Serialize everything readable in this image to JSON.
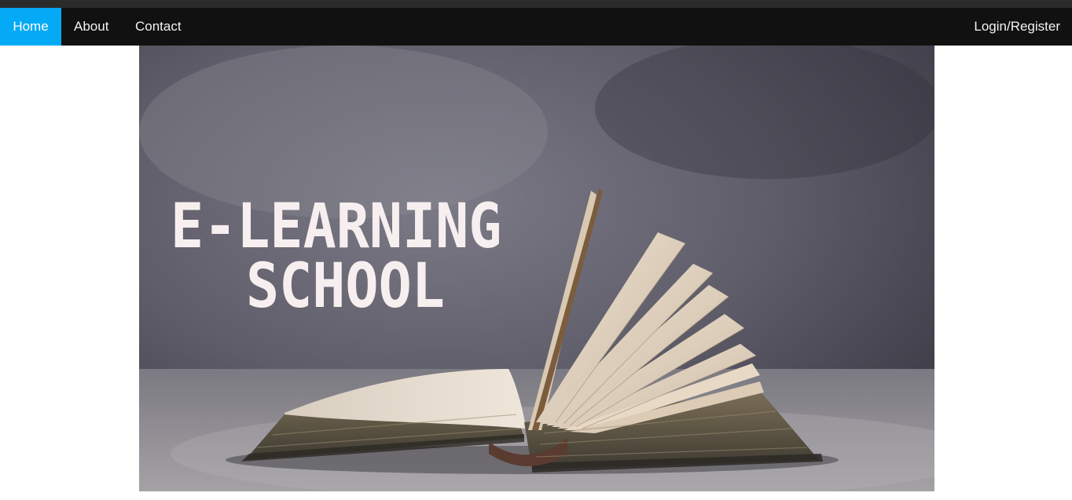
{
  "nav": {
    "home_label": "Home",
    "about_label": "About",
    "contact_label": "Contact",
    "login_label": "Login/Register"
  },
  "hero": {
    "title_line1": "E-LEARNING",
    "title_line2": "SCHOOL"
  },
  "colors": {
    "nav_background": "#111111",
    "nav_active": "#04aaf5",
    "nav_text": "#f2f2f2",
    "hero_text": "#f7efef"
  }
}
